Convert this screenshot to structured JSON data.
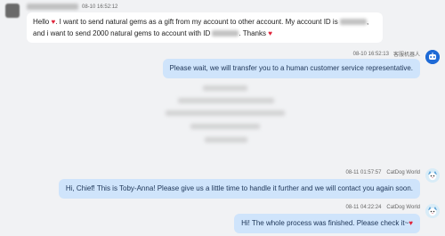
{
  "messages": [
    {
      "id": "m1",
      "side": "left",
      "timestamp": "08-10 16:52:12",
      "text_parts": {
        "hello": "Hello",
        "part1": ". I want to send natural gems as a gift from my account to other account. My account ID is",
        "part2": ", and i want to send 2000 natural gems to account with ID",
        "part3": ". Thanks"
      }
    },
    {
      "id": "m2",
      "side": "right",
      "timestamp": "08-10 16:52:13",
      "sender": "客服机器人",
      "text": "Please wait, we will transfer you to a human customer service representative."
    },
    {
      "id": "m3",
      "side": "right",
      "timestamp": "08-11 01:57:57",
      "sender": "CatDog World",
      "text": "Hi, Chief! This is Toby-Anna! Please give us a little time to handle it further and we will contact you again soon."
    },
    {
      "id": "m4",
      "side": "right",
      "timestamp": "08-11 04:22:24",
      "sender": "CatDog World",
      "text": "Hi! The whole process was finished. Please check it~"
    }
  ],
  "icons": {
    "heart": "♥",
    "bot": "robot-icon",
    "avatar": "catdog-avatar"
  },
  "colors": {
    "background": "#f1f2f4",
    "bubble_left": "#ffffff",
    "bubble_right": "#cfe4fb",
    "heart": "#e0243a",
    "bot_avatar": "#1e6ad6"
  }
}
